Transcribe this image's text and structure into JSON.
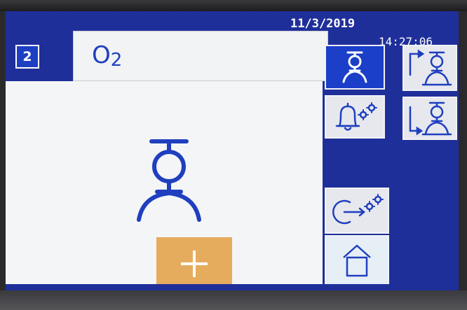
{
  "header": {
    "date": "11/3/2019",
    "time": "14:27:06"
  },
  "channel": {
    "number": "2",
    "gas_symbol": "O",
    "gas_subscript": "2"
  },
  "side_buttons": {
    "person": {
      "icon": "person-icon",
      "state": "active"
    },
    "person_up": {
      "icon": "person-up-icon"
    },
    "alarm_settings": {
      "icon": "bell-gear-icon"
    },
    "person_down": {
      "icon": "person-down-icon"
    },
    "exit_settings": {
      "icon": "exit-gear-icon"
    },
    "home": {
      "icon": "home-icon"
    }
  },
  "main": {
    "figure_icon": "person-icon",
    "add_button_icon": "plus-icon"
  },
  "colors": {
    "screen_blue": "#1f2f9a",
    "active_blue": "#1b3fc8",
    "icon_blue": "#1f3fbf",
    "panel_white": "#f4f5f7",
    "button_grey": "#e6e8ee",
    "add_orange": "#e5ac5e"
  }
}
